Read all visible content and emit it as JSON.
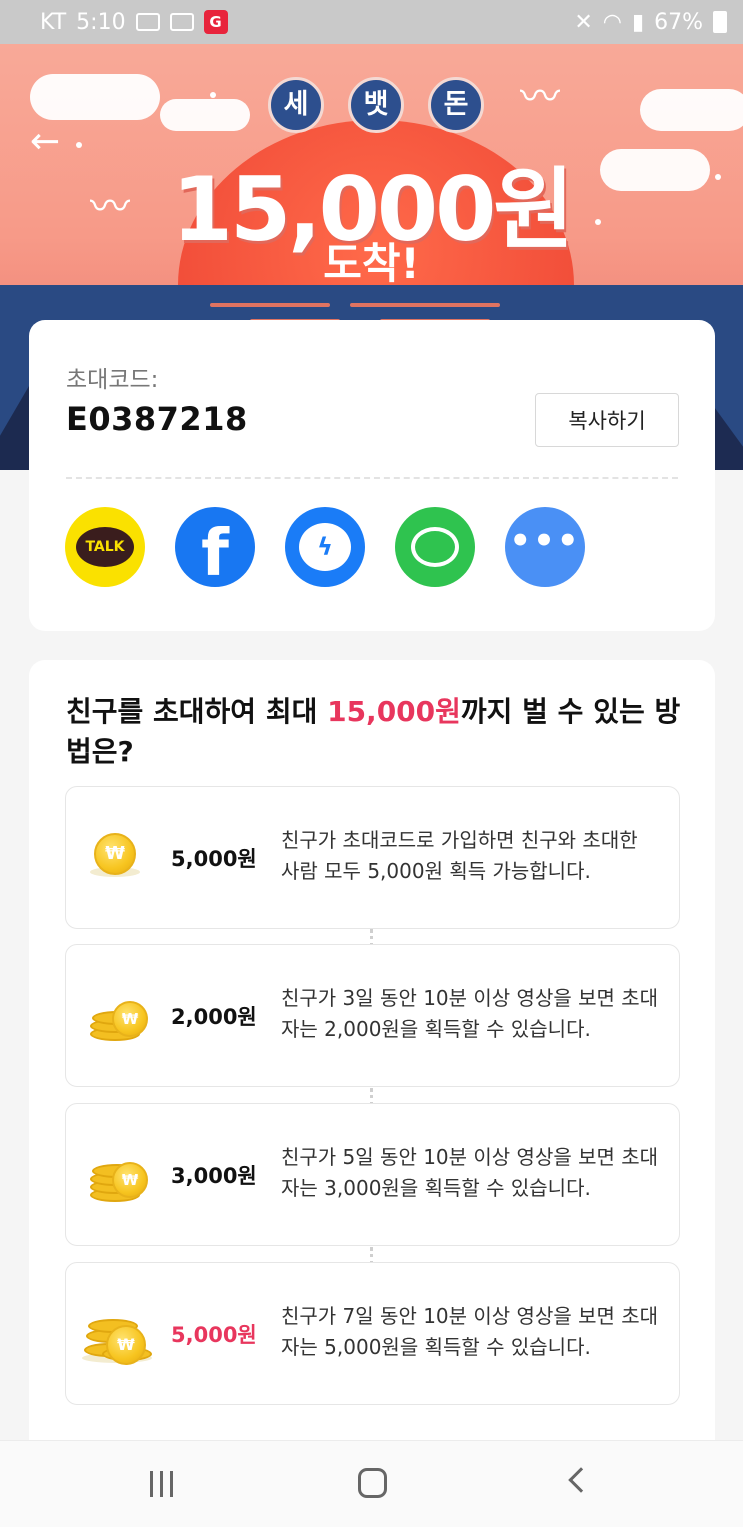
{
  "status_bar": {
    "carrier": "KT",
    "time": "5:10",
    "battery": "67%"
  },
  "banner": {
    "badges": [
      "세",
      "뱃",
      "돈"
    ],
    "amount": "15,000원",
    "subtitle": "도착!"
  },
  "invite": {
    "code_label": "초대코드:",
    "code_value": "E0387218",
    "copy_label": "복사하기",
    "share_targets": [
      {
        "name": "kakao",
        "icon": "kakaotalk-icon",
        "label": "TALK"
      },
      {
        "name": "facebook",
        "icon": "facebook-icon",
        "label": "f"
      },
      {
        "name": "messenger",
        "icon": "messenger-icon"
      },
      {
        "name": "message",
        "icon": "message-icon"
      },
      {
        "name": "more",
        "icon": "more-icon",
        "label": "•••"
      }
    ]
  },
  "info": {
    "title_prefix": "친구를 초대하여 최대 ",
    "title_highlight": "15,000원",
    "title_suffix": "까지 벌 수 있는 방법은?",
    "rewards": [
      {
        "amount": "5,000원",
        "description": "친구가 초대코드로 가입하면 친구와 초대한 사람 모두 5,000원 획득 가능합니다.",
        "highlight": false
      },
      {
        "amount": "2,000원",
        "description": "친구가 3일 동안 10분 이상 영상을 보면 초대자는 2,000원을 획득할 수 있습니다.",
        "highlight": false
      },
      {
        "amount": "3,000원",
        "description": "친구가 5일 동안 10분 이상 영상을 보면 초대자는 3,000원을 획득할 수 있습니다.",
        "highlight": false
      },
      {
        "amount": "5,000원",
        "description": "친구가 7일 동안 10분 이상 영상을 보면 초대자는 5,000원을 획득할 수 있습니다.",
        "highlight": true
      }
    ]
  },
  "colors": {
    "accent": "#e8365d",
    "sea": "#2a4a83",
    "sun": "#f24f3a",
    "kakao": "#fae100",
    "facebook": "#1877f2",
    "line_green": "#2fc34f"
  }
}
